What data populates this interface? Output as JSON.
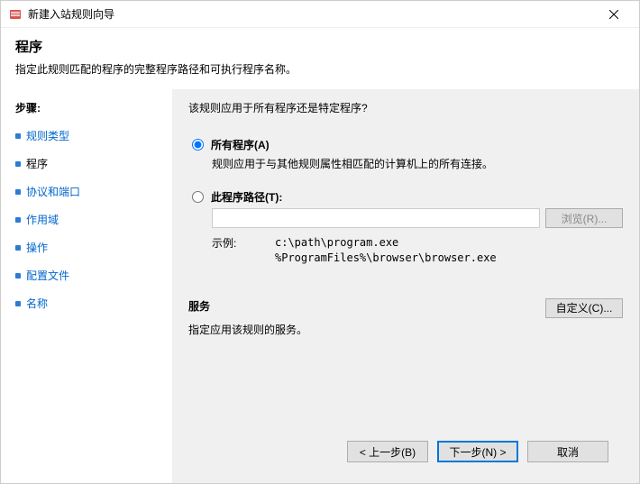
{
  "titlebar": {
    "title": "新建入站规则向导"
  },
  "header": {
    "title": "程序",
    "desc": "指定此规则匹配的程序的完整程序路径和可执行程序名称。"
  },
  "sidebar": {
    "heading": "步骤:",
    "items": [
      {
        "label": "规则类型"
      },
      {
        "label": "程序"
      },
      {
        "label": "协议和端口"
      },
      {
        "label": "作用域"
      },
      {
        "label": "操作"
      },
      {
        "label": "配置文件"
      },
      {
        "label": "名称"
      }
    ]
  },
  "content": {
    "question": "该规则应用于所有程序还是特定程序?",
    "opt_all": {
      "label": "所有程序(A)",
      "desc": "规则应用于与其他规则属性相匹配的计算机上的所有连接。"
    },
    "opt_path": {
      "label": "此程序路径(T):",
      "browse": "浏览(R)...",
      "example_label": "示例:",
      "example_code": "c:\\path\\program.exe\n%ProgramFiles%\\browser\\browser.exe"
    },
    "service": {
      "label": "服务",
      "custom": "自定义(C)...",
      "desc": "指定应用该规则的服务。"
    }
  },
  "footer": {
    "back": "< 上一步(B)",
    "next": "下一步(N) >",
    "cancel": "取消"
  }
}
